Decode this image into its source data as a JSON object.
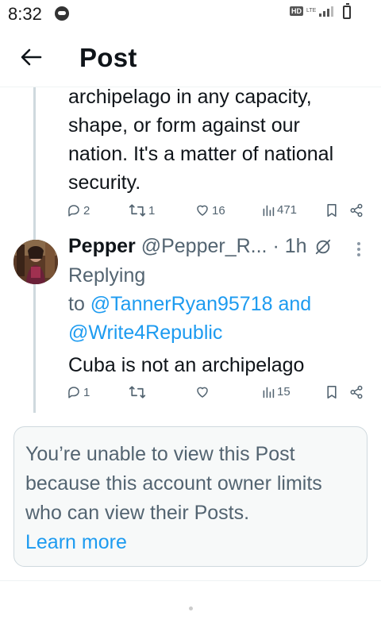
{
  "status_bar": {
    "time": "8:32",
    "network_badge": "HD",
    "network_type": "LTE",
    "battery_label": "battery"
  },
  "header": {
    "back_icon": "arrow-left-icon",
    "title": "Post"
  },
  "parent_post": {
    "lines": [
      "archipelago in any capacity,",
      "shape, or form against our",
      "nation. It's a matter of national",
      "security."
    ],
    "actions": {
      "replies": "2",
      "reposts": "1",
      "likes": "16",
      "views": "471"
    }
  },
  "reply_post": {
    "author_name": "Pepper",
    "author_handle": "@Pepper_R...",
    "time": " · 1h",
    "replying_label": "Replying",
    "to_label": "to ",
    "mention_1": "@TannerRyan95718",
    "and_label": " and",
    "mention_2": "@Write4Republic",
    "text": "Cuba is not an archipelago",
    "actions": {
      "replies": "1",
      "reposts": "",
      "likes": "",
      "views": "15"
    }
  },
  "notice": {
    "message": "You’re unable to view this Post because this account owner limits who can view their Posts.",
    "link": "Learn more"
  },
  "colors": {
    "accent": "#1d9bf0",
    "text_primary": "#0f1419",
    "text_secondary": "#536471",
    "thread_line": "#cfd9de"
  }
}
